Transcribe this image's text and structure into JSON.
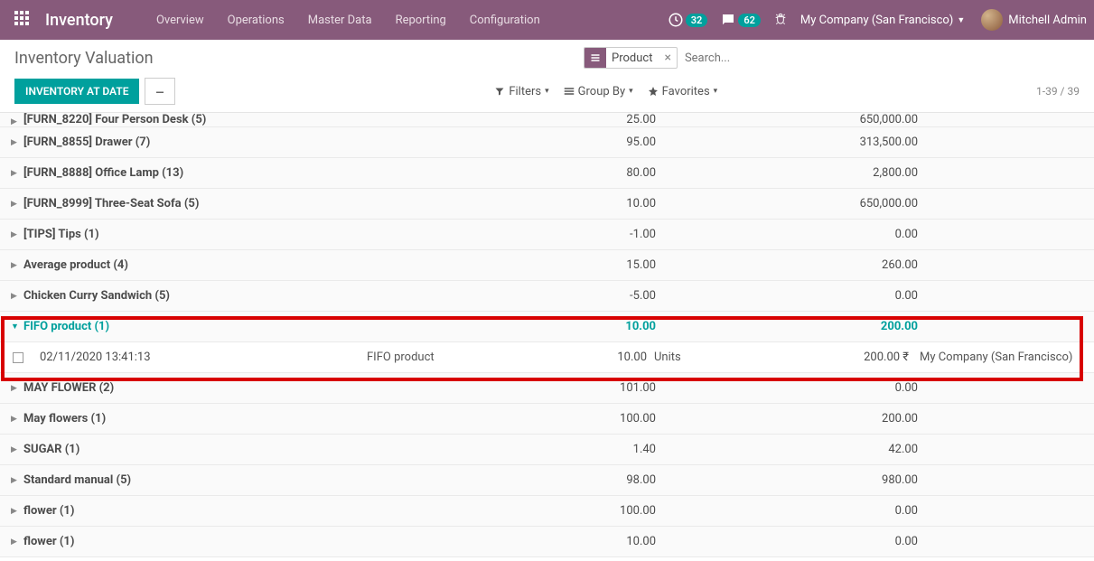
{
  "header": {
    "brand": "Inventory",
    "nav": [
      "Overview",
      "Operations",
      "Master Data",
      "Reporting",
      "Configuration"
    ],
    "clock_badge": "32",
    "chat_badge": "62",
    "company": "My Company (San Francisco)",
    "user": "Mitchell Admin"
  },
  "control": {
    "title": "Inventory Valuation",
    "facet_label": "Product",
    "search_placeholder": "Search...",
    "main_button": "INVENTORY AT DATE",
    "filters": "Filters",
    "groupby": "Group By",
    "favorites": "Favorites",
    "pager": "1-39 / 39"
  },
  "rows": [
    {
      "name": "[FURN_8220] Four Person Desk (5)",
      "qty": "25.00",
      "value": "650,000.00",
      "cut": true
    },
    {
      "name": "[FURN_8855] Drawer (7)",
      "qty": "95.00",
      "value": "313,500.00"
    },
    {
      "name": "[FURN_8888] Office Lamp (13)",
      "qty": "80.00",
      "value": "2,800.00"
    },
    {
      "name": "[FURN_8999] Three-Seat Sofa (5)",
      "qty": "10.00",
      "value": "650,000.00"
    },
    {
      "name": "[TIPS] Tips (1)",
      "qty": "-1.00",
      "value": "0.00"
    },
    {
      "name": "Average product (4)",
      "qty": "15.00",
      "value": "260.00"
    },
    {
      "name": "Chicken Curry Sandwich (5)",
      "qty": "-5.00",
      "value": "0.00"
    },
    {
      "name": "FIFO product (1)",
      "qty": "10.00",
      "value": "200.00",
      "expanded": true,
      "detail": {
        "date": "02/11/2020 13:41:13",
        "product": "FIFO product",
        "qty": "10.00",
        "unit": "Units",
        "value": "200.00 ₹",
        "company": "My Company (San Francisco)"
      }
    },
    {
      "name": "MAY FLOWER (2)",
      "qty": "101.00",
      "value": "0.00"
    },
    {
      "name": "May flowers (1)",
      "qty": "100.00",
      "value": "200.00"
    },
    {
      "name": "SUGAR (1)",
      "qty": "1.40",
      "value": "42.00"
    },
    {
      "name": "Standard manual (5)",
      "qty": "98.00",
      "value": "980.00"
    },
    {
      "name": "flower (1)",
      "qty": "100.00",
      "value": "0.00"
    },
    {
      "name": "flower (1)",
      "qty": "10.00",
      "value": "0.00"
    }
  ]
}
